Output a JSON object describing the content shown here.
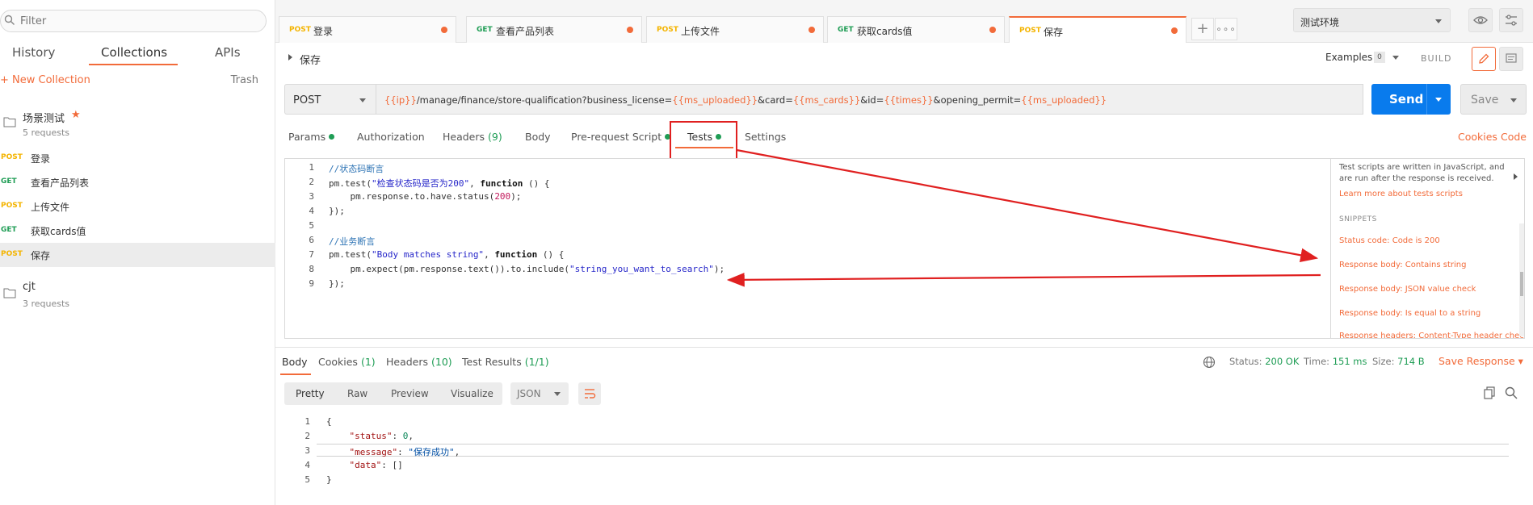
{
  "sidebar": {
    "filter_placeholder": "Filter",
    "tabs": [
      "History",
      "Collections",
      "APIs"
    ],
    "new_collection": "+ New Collection",
    "trash": "Trash",
    "collections": [
      {
        "name": "场景测试",
        "count": "5 requests",
        "starred": true
      },
      {
        "name": "cjt",
        "count": "3 requests",
        "starred": false
      }
    ],
    "requests": [
      {
        "method": "POST",
        "name": "登录"
      },
      {
        "method": "GET",
        "name": "查看产品列表"
      },
      {
        "method": "POST",
        "name": "上传文件"
      },
      {
        "method": "GET",
        "name": "获取cards值"
      },
      {
        "method": "POST",
        "name": "保存"
      }
    ]
  },
  "tabs": [
    {
      "method": "POST",
      "name": "登录"
    },
    {
      "method": "GET",
      "name": "查看产品列表"
    },
    {
      "method": "POST",
      "name": "上传文件"
    },
    {
      "method": "GET",
      "name": "获取cards值"
    },
    {
      "method": "POST",
      "name": "保存"
    }
  ],
  "environment": "测试环境",
  "request": {
    "title": "保存",
    "examples_label": "Examples",
    "examples_count": "0",
    "build_label": "BUILD",
    "method": "POST",
    "url_parts": [
      {
        "t": "{{ip}}",
        "v": true
      },
      {
        "t": "/manage/finance/store-qualification?business_license=",
        "v": false
      },
      {
        "t": "{{ms_uploaded}}",
        "v": true
      },
      {
        "t": "&card=",
        "v": false
      },
      {
        "t": "{{ms_cards}}",
        "v": true
      },
      {
        "t": "&id=",
        "v": false
      },
      {
        "t": "{{times}}",
        "v": true
      },
      {
        "t": "&opening_permit=",
        "v": false
      },
      {
        "t": "{{ms_uploaded}}",
        "v": true
      }
    ],
    "send_label": "Send",
    "save_label": "Save",
    "subtabs": {
      "params": "Params",
      "authorization": "Authorization",
      "headers": "Headers",
      "headers_count": "(9)",
      "body": "Body",
      "prerequest": "Pre-request Script",
      "tests": "Tests",
      "settings": "Settings"
    },
    "cookies_link": "Cookies",
    "code_link": "Code"
  },
  "tests_code": {
    "line_numbers": [
      "1",
      "2",
      "3",
      "4",
      "5",
      "6",
      "7",
      "8",
      "9"
    ]
  },
  "snippets": {
    "description": "Test scripts are written in JavaScript, and are run after the response is received.",
    "learn_more": "Learn more about tests scripts",
    "heading": "SNIPPETS",
    "items": [
      "Status code: Code is 200",
      "Response body: Contains string",
      "Response body: JSON value check",
      "Response body: Is equal to a string",
      "Response headers: Content-Type header check"
    ]
  },
  "response": {
    "tabs": {
      "body": "Body",
      "cookies": "Cookies",
      "cookies_count": "(1)",
      "headers": "Headers",
      "headers_count": "(10)",
      "tests": "Test Results",
      "tests_count": "(1/1)"
    },
    "status_label": "Status:",
    "status_value": "200 OK",
    "time_label": "Time:",
    "time_value": "151 ms",
    "size_label": "Size:",
    "size_value": "714 B",
    "save_response": "Save Response",
    "views": [
      "Pretty",
      "Raw",
      "Preview",
      "Visualize"
    ],
    "format": "JSON",
    "line_numbers": [
      "1",
      "2",
      "3",
      "4",
      "5"
    ]
  },
  "colors": {
    "accent": "#f26b3a",
    "send": "#097bed",
    "post": "#f4b400",
    "get": "#1f9d55",
    "annotation": "#e02020"
  }
}
